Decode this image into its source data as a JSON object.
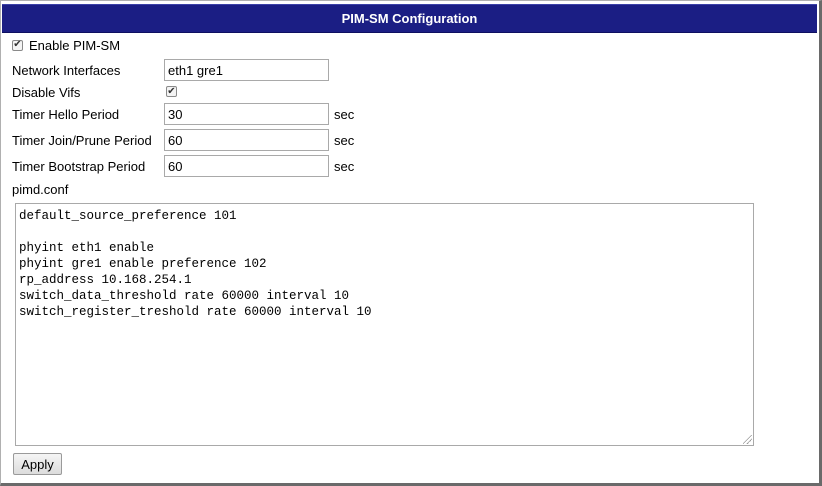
{
  "panel": {
    "title": "PIM-SM Configuration"
  },
  "form": {
    "enable_pimsm": {
      "label": "Enable PIM-SM",
      "checked": true
    },
    "network_interfaces": {
      "label": "Network Interfaces",
      "value": "eth1 gre1"
    },
    "disable_vifs": {
      "label": "Disable Vifs",
      "checked": true
    },
    "timer_hello": {
      "label": "Timer Hello Period",
      "value": "30",
      "unit": "sec"
    },
    "timer_join_prune": {
      "label": "Timer Join/Prune Period",
      "value": "60",
      "unit": "sec"
    },
    "timer_bootstrap": {
      "label": "Timer Bootstrap Period",
      "value": "60",
      "unit": "sec"
    },
    "config_file": {
      "label": "pimd.conf",
      "content": "default_source_preference 101\n\nphyint eth1 enable\nphyint gre1 enable preference 102\nrp_address 10.168.254.1\nswitch_data_threshold rate 60000 interval 10\nswitch_register_treshold rate 60000 interval 10"
    }
  },
  "actions": {
    "apply_label": "Apply"
  },
  "icons": {
    "check": "check-mark-icon"
  }
}
